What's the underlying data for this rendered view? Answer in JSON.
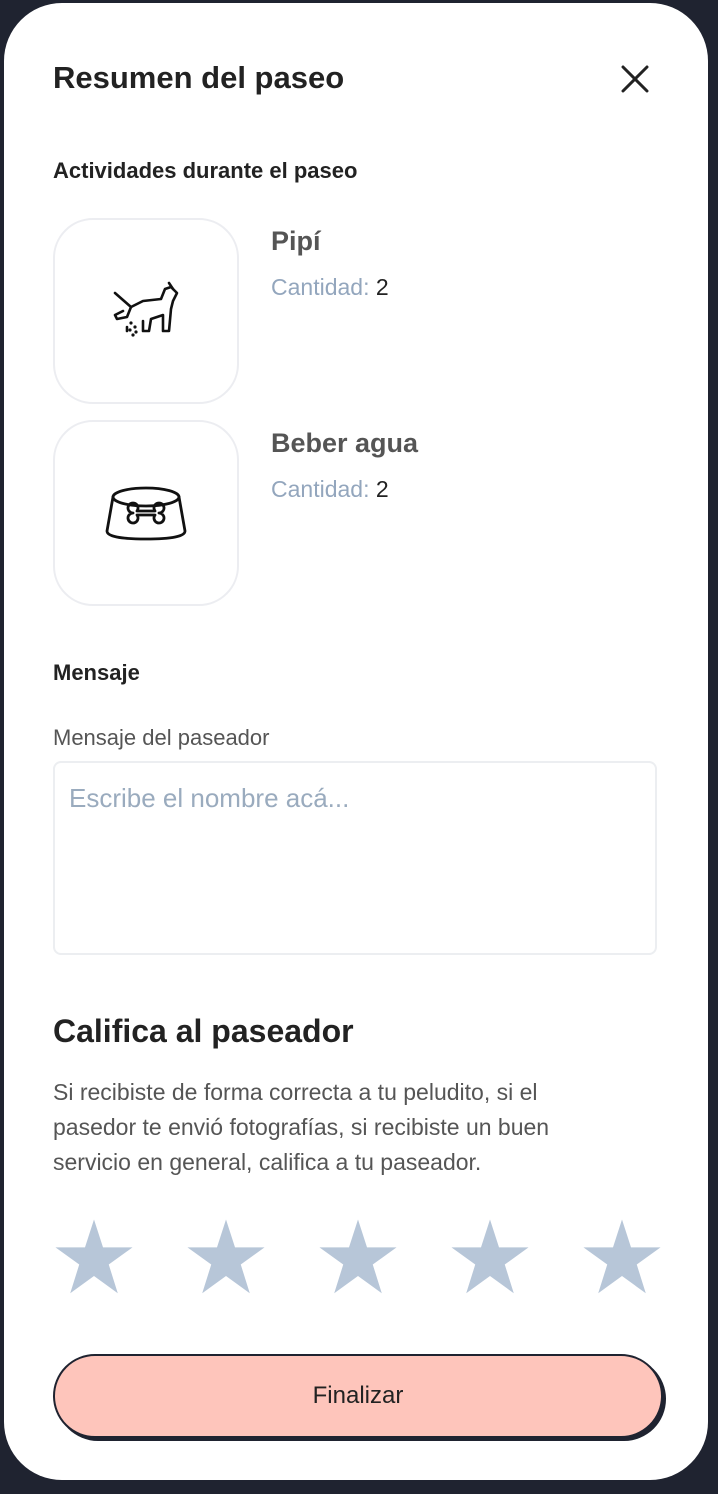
{
  "header": {
    "title": "Resumen del paseo",
    "close_icon": "close-icon"
  },
  "activities": {
    "section_label": "Actividades durante el paseo",
    "items": [
      {
        "name": "Pipí",
        "quantity_label": "Cantidad:",
        "quantity": "2",
        "icon": "dog-peeing-icon"
      },
      {
        "name": "Beber agua",
        "quantity_label": "Cantidad:",
        "quantity": "2",
        "icon": "dog-bowl-icon"
      }
    ]
  },
  "message": {
    "section_label": "Mensaje",
    "field_label": "Mensaje del paseador",
    "placeholder": "Escribe el nombre acá...",
    "value": ""
  },
  "rating": {
    "title": "Califica al paseador",
    "description": "Si recibiste de forma correcta a tu peludito, si el pasedor te envió fotografías, si recibiste un buen servicio en general, califica a tu paseador.",
    "star_count": 5,
    "selected": 0,
    "star_color": "#b7c6d8"
  },
  "actions": {
    "finish_label": "Finalizar"
  },
  "colors": {
    "accent_button": "#fec5bb",
    "frame": "#1f2330",
    "muted_label": "#93a6bd"
  }
}
